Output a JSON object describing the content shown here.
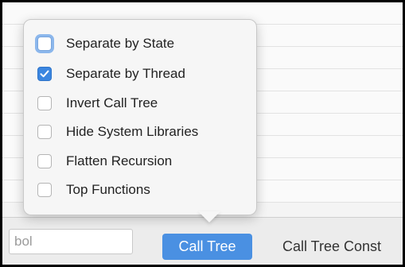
{
  "options": [
    {
      "label": "Separate by State",
      "checked": false,
      "focused": true
    },
    {
      "label": "Separate by Thread",
      "checked": true,
      "focused": false
    },
    {
      "label": "Invert Call Tree",
      "checked": false,
      "focused": false
    },
    {
      "label": "Hide System Libraries",
      "checked": false,
      "focused": false
    },
    {
      "label": "Flatten Recursion",
      "checked": false,
      "focused": false
    },
    {
      "label": "Top Functions",
      "checked": false,
      "focused": false
    }
  ],
  "toolbar": {
    "search_value": "bol",
    "tab_active_label": "Call Tree",
    "tab_inactive_label": "Call Tree Const"
  },
  "colors": {
    "accent": "#4a90e2",
    "checkbox_checked": "#3b86e0",
    "focus_ring": "#8cb7ec"
  },
  "icons": {
    "checked": "checkmark-icon"
  }
}
